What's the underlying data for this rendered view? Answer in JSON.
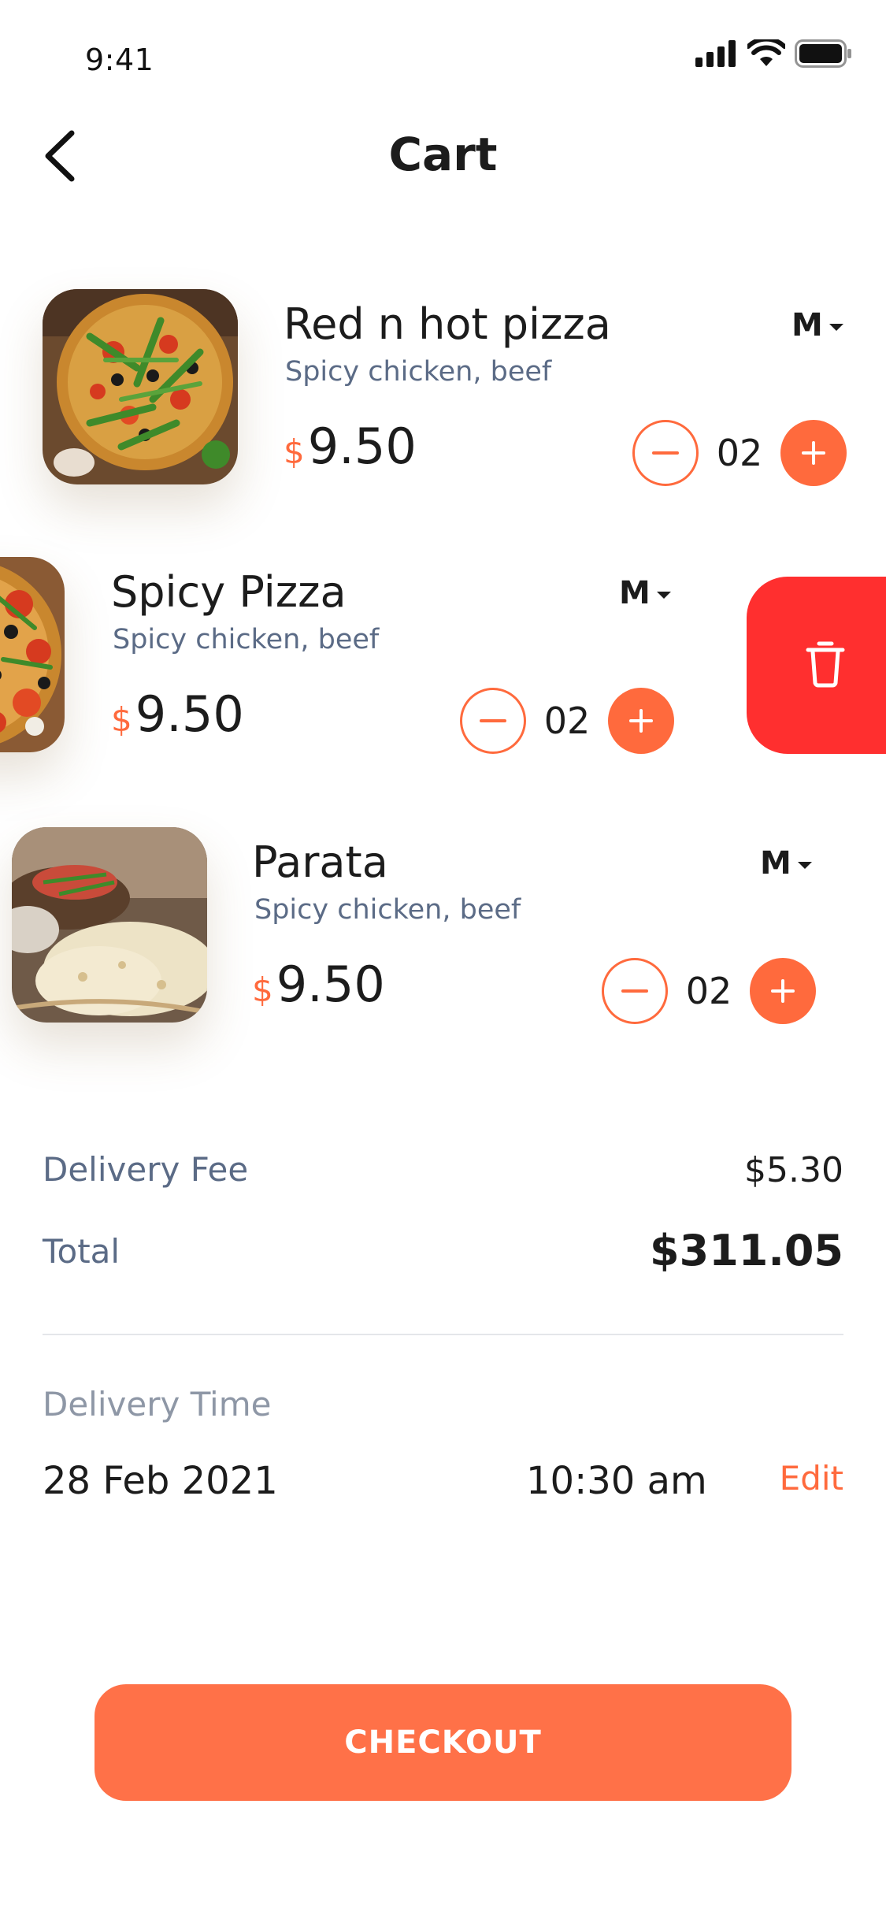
{
  "status_bar": {
    "time": "9:41"
  },
  "header": {
    "title": "Cart"
  },
  "cart": {
    "items": [
      {
        "name": "Red n hot pizza",
        "description": "Spicy chicken, beef",
        "currency": "$",
        "price": "9.50",
        "size": "M",
        "quantity": "02",
        "image": "pizza-arugula-image"
      },
      {
        "name": "Spicy Pizza",
        "description": "Spicy chicken, beef",
        "currency": "$",
        "price": "9.50",
        "size": "M",
        "quantity": "02",
        "image": "pepperoni-pizza-image"
      },
      {
        "name": "Parata",
        "description": "Spicy chicken, beef",
        "currency": "$",
        "price": "9.50",
        "size": "M",
        "quantity": "02",
        "image": "paratha-flatbread-image"
      }
    ]
  },
  "summary": {
    "delivery_fee_label": "Delivery Fee",
    "delivery_fee_value": "$5.30",
    "total_label": "Total",
    "total_value": "$311.05"
  },
  "delivery": {
    "heading": "Delivery Time",
    "date": "28 Feb 2021",
    "time": "10:30 am",
    "edit_label": "Edit"
  },
  "checkout": {
    "label": "CHECKOUT"
  },
  "colors": {
    "accent": "#ff6a3d",
    "checkout": "#ff7148",
    "delete": "#ff2f2f",
    "muted_text": "#5b6b86"
  },
  "icons": [
    "back-arrow-icon",
    "cellular-signal-icon",
    "wifi-icon",
    "battery-icon",
    "minus-icon",
    "plus-icon",
    "trash-icon",
    "caret-down-icon"
  ]
}
